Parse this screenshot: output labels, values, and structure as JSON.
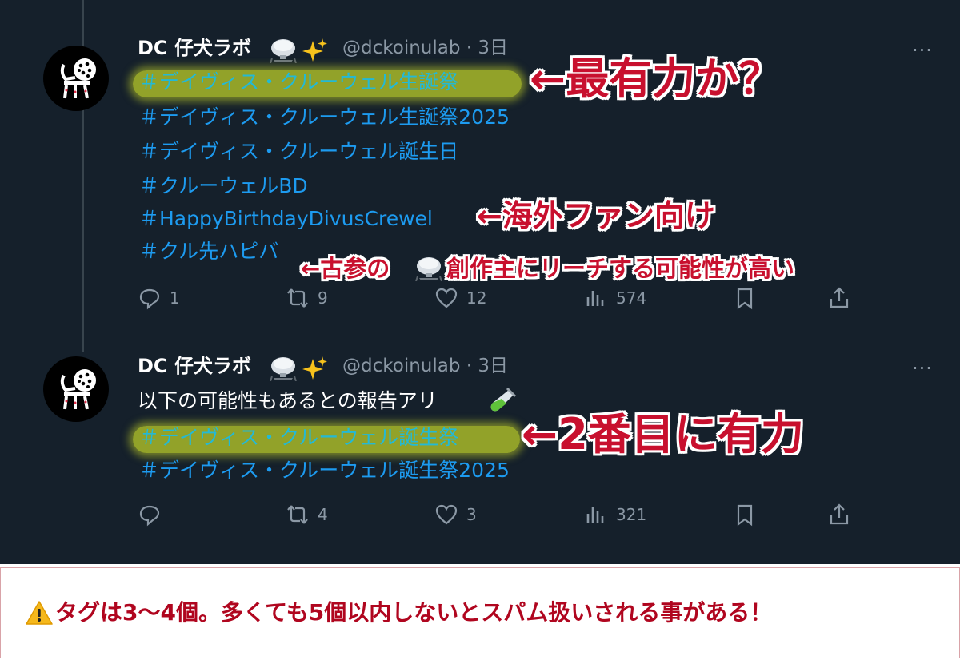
{
  "tweets": [
    {
      "display_name": "DC 仔犬ラボ",
      "handle_time": "@dckoinulab · 3日",
      "more": "···",
      "intro": "",
      "hashtags": [
        "＃デイヴィス・クルーウェル生誕祭",
        "＃デイヴィス・クルーウェル生誕祭2025",
        "＃デイヴィス・クルーウェル誕生日",
        "＃クルーウェルBD",
        "＃HappyBirthdayDivusCrewel",
        "＃クル先ハピバ"
      ],
      "actions": {
        "reply": "1",
        "retweet": "9",
        "like": "12",
        "views": "574"
      }
    },
    {
      "display_name": "DC 仔犬ラボ",
      "handle_time": "@dckoinulab · 3日",
      "more": "···",
      "intro": "以下の可能性もあるとの報告アリ",
      "hashtags": [
        "＃デイヴィス・クルーウェル誕生祭",
        "＃デイヴィス・クルーウェル誕生祭2025"
      ],
      "actions": {
        "reply": "",
        "retweet": "4",
        "like": "3",
        "views": "321"
      }
    }
  ],
  "annotations": {
    "most_likely": "←最有力か？",
    "overseas_fans": "←海外ファン向け",
    "veteran_prefix": "←古参の",
    "veteran_suffix": "創作主にリーチする可能性が高い",
    "second": "←2番目に有力"
  },
  "notice": {
    "text": "タグは3〜4個。多くても5個以内しないとスパム扱いされる事がある！",
    "icon": "warning-icon"
  },
  "colors": {
    "background": "#15202b",
    "hashtag": "#1d9bf0",
    "highlight": "#c4d428",
    "annotation": "#c8102e",
    "notice_text": "#b0061f"
  },
  "icons": [
    "flask-icon",
    "sparkles-icon",
    "test-tube-icon",
    "reply-icon",
    "retweet-icon",
    "like-icon",
    "views-icon",
    "bookmark-icon",
    "share-icon",
    "more-icon"
  ]
}
